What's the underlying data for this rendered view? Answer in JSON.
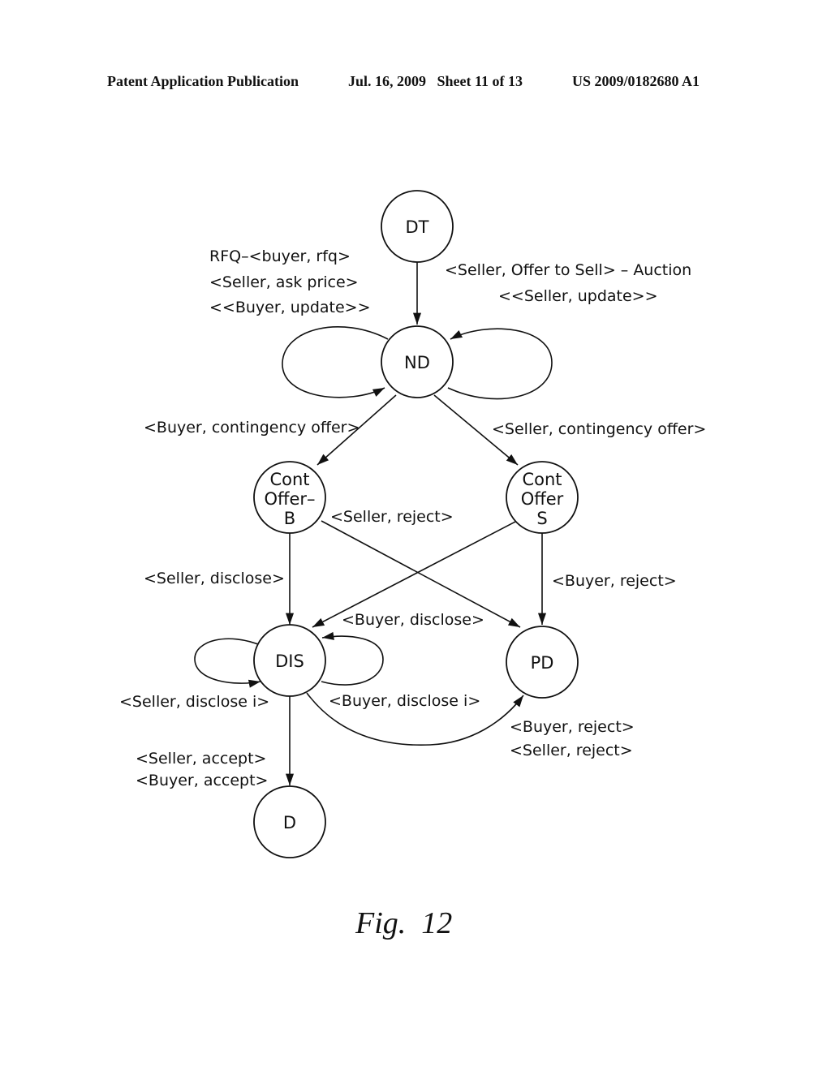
{
  "header": {
    "publication": "Patent Application Publication",
    "date_sheet": "Jul. 16, 2009   Sheet 11 of 13",
    "number": "US 2009/0182680 A1"
  },
  "nodes": {
    "dt": [
      "DT"
    ],
    "nd": [
      "ND"
    ],
    "cont_offer_b": [
      "Cont",
      "Offer–",
      "B"
    ],
    "cont_offer_s": [
      "Cont",
      "Offer",
      "S"
    ],
    "dis": [
      "DIS"
    ],
    "pd": [
      "PD"
    ],
    "d": [
      "D"
    ]
  },
  "labels": {
    "nd_left_loop": [
      "RFQ–<buyer, rfq>",
      "<Seller, ask price>",
      "<<Buyer, update>>"
    ],
    "dt_to_nd": [
      "<Seller, Offer to Sell> – Auction",
      "<<Seller, update>>"
    ],
    "nd_to_cob": "<Buyer, contingency offer>",
    "nd_to_cos": "<Seller, contingency offer>",
    "cob_to_pd": "<Seller, reject>",
    "cob_to_dis": "<Seller, disclose>",
    "cos_to_pd": "<Buyer, reject>",
    "cos_to_dis": "<Buyer, disclose>",
    "dis_left_loop": "<Seller, disclose i>",
    "dis_right_loop": "<Buyer, disclose i>",
    "dis_to_pd": [
      "<Buyer, reject>",
      "<Seller, reject>"
    ],
    "dis_to_d": [
      "<Seller, accept>",
      "<Buyer, accept>"
    ]
  },
  "figure_caption": "Fig.  12"
}
